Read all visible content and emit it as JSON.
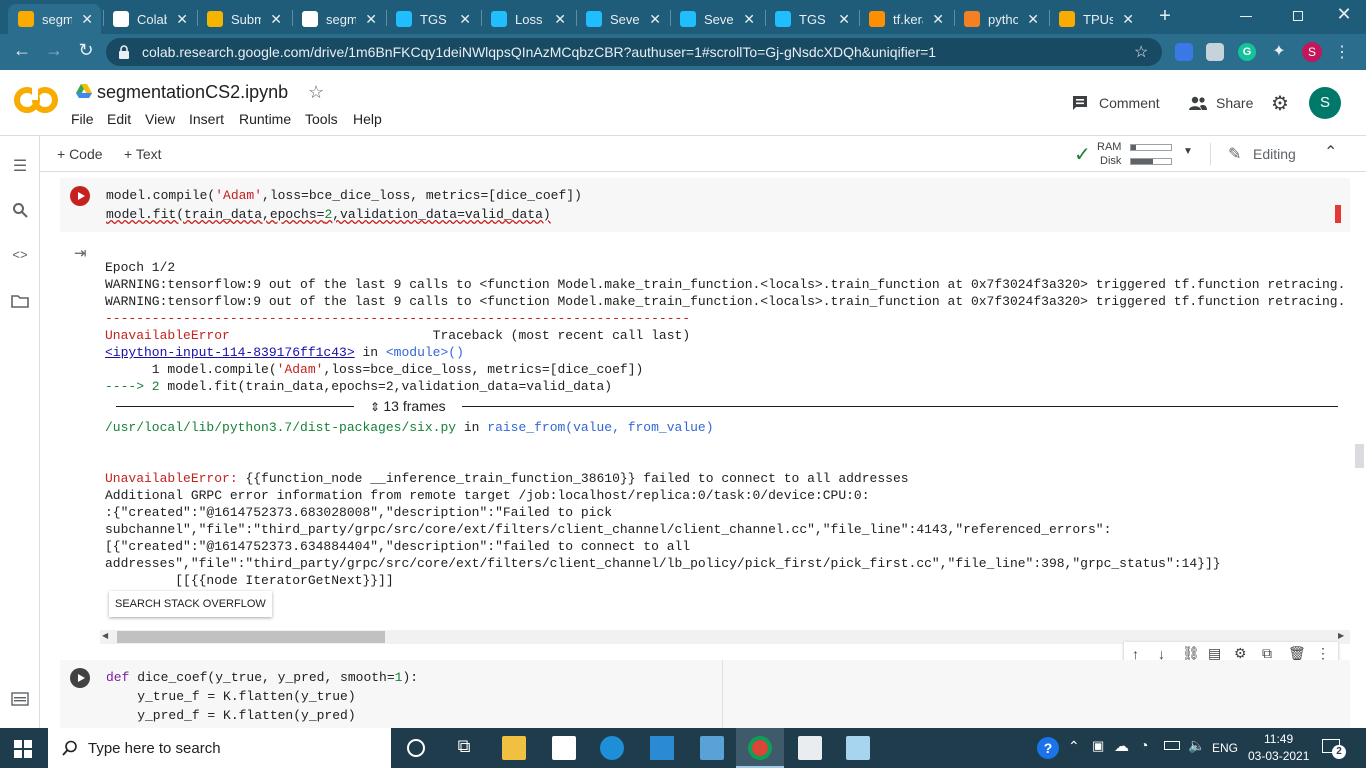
{
  "tabs": [
    {
      "title": "segm",
      "favicon": "colab-icon",
      "color": "#f9ab00"
    },
    {
      "title": "Colab",
      "favicon": "github-icon",
      "color": "#ffffff"
    },
    {
      "title": "Subm",
      "favicon": "submit-icon",
      "color": "#f4b400"
    },
    {
      "title": "segm",
      "favicon": "github-icon",
      "color": "#ffffff"
    },
    {
      "title": "TGS S",
      "favicon": "kaggle-icon",
      "color": "#20beff"
    },
    {
      "title": "Loss F",
      "favicon": "kaggle-icon",
      "color": "#20beff"
    },
    {
      "title": "Sever",
      "favicon": "kaggle-icon",
      "color": "#20beff"
    },
    {
      "title": "Sever",
      "favicon": "kaggle-icon",
      "color": "#20beff"
    },
    {
      "title": "TGS S",
      "favicon": "kaggle-icon",
      "color": "#20beff"
    },
    {
      "title": "tf.kera",
      "favicon": "tensorflow-icon",
      "color": "#ff8f00"
    },
    {
      "title": "pytho",
      "favicon": "stackoverflow-icon",
      "color": "#f48024"
    },
    {
      "title": "TPUs",
      "favicon": "colab-icon",
      "color": "#f9ab00"
    }
  ],
  "browser": {
    "url": "colab.research.google.com/drive/1m6BnFKCqy1deiNWlqpsQInAzMCqbzCBR?authuser=1#scrollTo=Gj-gNsdcXDQh&uniqifier=1",
    "new_tab": "+",
    "avatar_letter": "S"
  },
  "colab": {
    "logo": "CO",
    "filename": "segmentationCS2.ipynb",
    "menu": [
      "File",
      "Edit",
      "View",
      "Insert",
      "Runtime",
      "Tools",
      "Help"
    ],
    "comment": "Comment",
    "share": "Share",
    "avatar_letter": "S",
    "add_code": "+ Code",
    "add_text": "+ Text",
    "ram_label": "RAM",
    "disk_label": "Disk",
    "editing": "Editing"
  },
  "cell1": {
    "line1_a": "model.compile(",
    "line1_str": "'Adam'",
    "line1_b": ",loss=bce_dice_loss, metrics=[dice_coef])",
    "line2_a": "model.fit(train_data,epochs=",
    "line2_num": "2",
    "line2_b": ",validation_data=valid_data)"
  },
  "output": {
    "epoch": "Epoch 1/2",
    "warn1": "WARNING:tensorflow:9 out of the last 9 calls to <function Model.make_train_function.<locals>.train_function at 0x7f3024f3a320> triggered tf.function retracing. Tr",
    "warn2": "WARNING:tensorflow:9 out of the last 9 calls to <function Model.make_train_function.<locals>.train_function at 0x7f3024f3a320> triggered tf.function retracing. Tr",
    "dashes": "---------------------------------------------------------------------------",
    "err_name": "UnavailableError",
    "traceback": "Traceback (most recent call last)",
    "input_link": "<ipython-input-114-839176ff1c43>",
    "in_word": " in ",
    "module": "<module>()",
    "tb1_a": "      1 model.compile(",
    "tb1_str": "'Adam'",
    "tb1_b": ",loss=bce_dice_loss, metrics=[dice_coef])",
    "tb2_arrow": "----> 2 ",
    "tb2_b": "model.fit(train_data,epochs=2,validation_data=valid_data)",
    "frames": "13 frames",
    "six_path": "/usr/local/lib/python3.7/dist-packages/six.py",
    "six_in": " in ",
    "six_fn": "raise_from(value, from_value)",
    "err_line": "UnavailableError: ",
    "err_msg": "{{function_node __inference_train_function_38610}} failed to connect to all addresses",
    "grpc1": "Additional GRPC error information from remote target /job:localhost/replica:0/task:0/device:CPU:0:",
    "grpc2": ":{\"created\":\"@1614752373.683028008\",\"description\":\"Failed to pick",
    "grpc3": "subchannel\",\"file\":\"third_party/grpc/src/core/ext/filters/client_channel/client_channel.cc\",\"file_line\":4143,\"referenced_errors\":",
    "grpc4": "[{\"created\":\"@1614752373.634884404\",\"description\":\"failed to connect to all",
    "grpc5": "addresses\",\"file\":\"third_party/grpc/src/core/ext/filters/client_channel/lb_policy/pick_first/pick_first.cc\",\"file_line\":398,\"grpc_status\":14}]}",
    "grpc6": "         [[{{node IteratorGetNext}}]]",
    "so_button": "SEARCH STACK OVERFLOW"
  },
  "cell2": {
    "l1_def": "def",
    "l1_rest": " dice_coef(y_true, y_pred, smooth=",
    "l1_num": "1",
    "l1_end": "):",
    "l2": "    y_true_f = K.flatten(y_true)",
    "l3": "    y_pred_f = K.flatten(y_pred)"
  },
  "taskbar": {
    "search": "Type here to search",
    "lang": "ENG",
    "time": "11:49",
    "date": "03-03-2021",
    "notif_count": "2"
  }
}
